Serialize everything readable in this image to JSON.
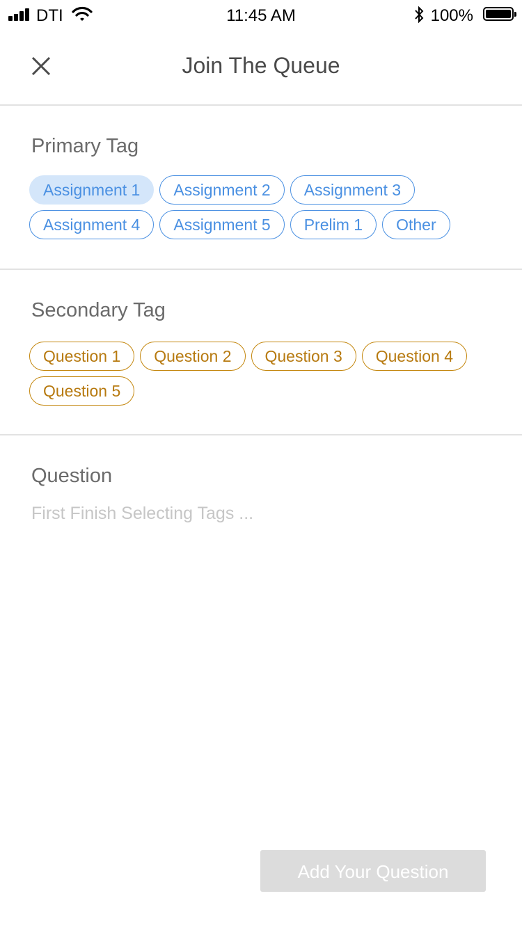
{
  "status_bar": {
    "carrier": "DTI",
    "time": "11:45 AM",
    "battery": "100%",
    "icons": [
      "signal-icon",
      "wifi-icon",
      "bluetooth-icon",
      "battery-icon"
    ]
  },
  "header": {
    "title": "Join The Queue",
    "close_icon": "close-icon"
  },
  "primary": {
    "title": "Primary Tag",
    "selected": "Assignment 1",
    "tags": [
      "Assignment 1",
      "Assignment 2",
      "Assignment 3",
      "Assignment 4",
      "Assignment 5",
      "Prelim 1",
      "Other"
    ]
  },
  "secondary": {
    "title": "Secondary Tag",
    "tags": [
      "Question 1",
      "Question 2",
      "Question 3",
      "Question 4",
      "Question 5"
    ]
  },
  "question": {
    "title": "Question",
    "placeholder": "First Finish Selecting Tags ...",
    "value": ""
  },
  "submit": {
    "label": "Add Your Question"
  },
  "colors": {
    "primary_tag": "#4a90e2",
    "primary_tag_selected_bg": "#d4e6fa",
    "secondary_tag": "#b77a10",
    "divider": "#e2e2e2",
    "disabled_button": "#dcdcdc"
  }
}
